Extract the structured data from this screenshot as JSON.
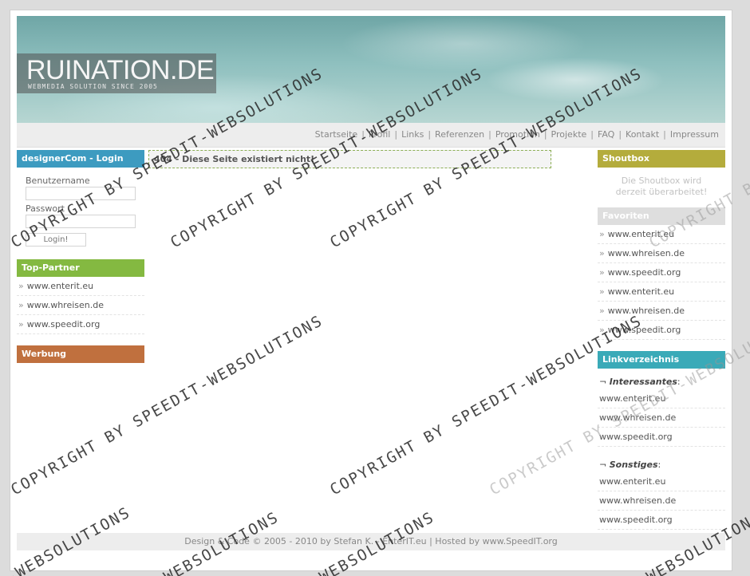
{
  "header": {
    "logo_title": "RUINATION.DE",
    "logo_subtitle": "WEBMEDIA SOLUTION SINCE 2005"
  },
  "nav": [
    "Startseite",
    "Profil",
    "Links",
    "Referenzen",
    "Promotion",
    "Projekte",
    "FAQ",
    "Kontakt",
    "Impressum"
  ],
  "login": {
    "title": "designerCom - Login",
    "username_label": "Benutzername",
    "username_value": "",
    "password_label": "Passwort",
    "password_value": "",
    "button_label": "Login!"
  },
  "top_partner": {
    "title": "Top-Partner",
    "links": [
      "www.enterit.eu",
      "www.whreisen.de",
      "www.speedit.org"
    ]
  },
  "werbung": {
    "title": "Werbung"
  },
  "content": {
    "error_message": "404 - Diese Seite existiert nicht!"
  },
  "shoutbox": {
    "title": "Shoutbox",
    "message_line1": "Die Shoutbox wird",
    "message_line2": "derzeit überarbeitet!"
  },
  "favoriten": {
    "title": "Favoriten",
    "links": [
      "www.enterit.eu",
      "www.whreisen.de",
      "www.speedit.org",
      "www.enterit.eu",
      "www.whreisen.de",
      "www.speedit.org"
    ]
  },
  "linkverzeichnis": {
    "title": "Linkverzeichnis",
    "categories": [
      {
        "name": "Interessantes",
        "links": [
          "www.enterit.eu",
          "www.whreisen.de",
          "www.speedit.org"
        ]
      },
      {
        "name": "Sonstiges",
        "links": [
          "www.enterit.eu",
          "www.whreisen.de",
          "www.speedit.org"
        ]
      }
    ]
  },
  "footer": {
    "text": "Design & Code © 2005 - 2010 by Stefan K. - EnterIT.eu | Hosted by www.SpeedIT.org"
  },
  "watermark": {
    "text_main": "COPYRIGHT BY SPEEDIT-WEBSOLUTIONS",
    "text_fragment": "-WEBSOLUTIONS"
  },
  "colors": {
    "login_title": "#3d9bc0",
    "top_partner_title": "#84b941",
    "werbung_title": "#c0703e",
    "shoutbox_title": "#b4ac3c",
    "favoriten_title": "#dedede",
    "linkverzeichnis_title": "#3aaab8"
  }
}
